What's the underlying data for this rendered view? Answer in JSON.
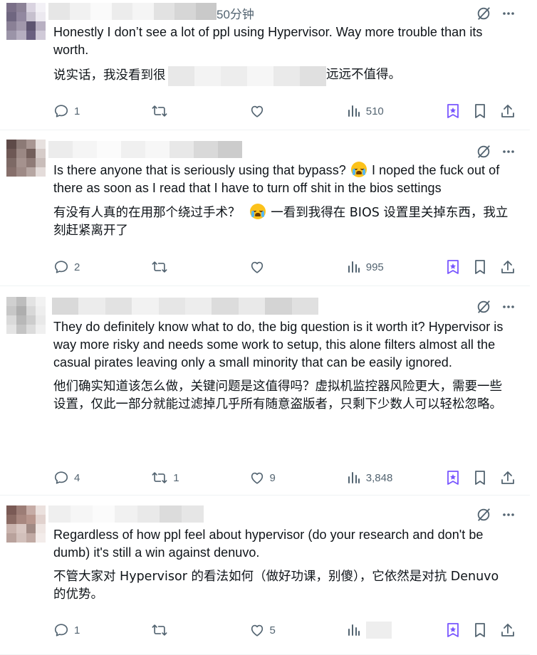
{
  "posts": [
    {
      "time": "50分钟",
      "text_en": "Honestly I don’t see a lot of ppl using Hypervisor. Way more trouble than its worth.",
      "text_zh_start": "说实话，我没看到很",
      "text_zh_end": "远远不值得。",
      "replies": "1",
      "reposts": "",
      "likes": "",
      "views": "510"
    },
    {
      "text_en_before": "Is there anyone that is seriously using that bypass?",
      "text_en_after": "I noped the fuck out of there as soon as I read that I have to turn off shit in the bios settings",
      "text_zh_before": "有没有人真的在用那个绕过手术？",
      "text_zh_after": "一看到我得在 BIOS 设置里关掉东西，我立刻赶紧离开了",
      "replies": "2",
      "reposts": "",
      "likes": "",
      "views": "995"
    },
    {
      "text_en": "They do definitely know what to do, the big question is it worth it? Hypervisor is way more risky and needs some work to setup, this alone filters almost all the casual pirates leaving only a small minority that can be easily ignored.",
      "text_zh": "他们确实知道该怎么做，关键问题是这值得吗？虚拟机监控器风险更大，需要一些设置，仅此一部分就能过滤掉几乎所有随意盗版者，只剩下少数人可以轻松忽略。",
      "replies": "4",
      "reposts": "1",
      "likes": "9",
      "views": "3,848"
    },
    {
      "text_en": "Regardless of how ppl feel about hypervisor (do your research and don't be dumb) it's still a win against denuvo.",
      "text_zh": "不管大家对 Hypervisor 的看法如何（做好功课，别傻），它依然是对抗 Denuvo 的优势。",
      "replies": "1",
      "reposts": "",
      "likes": "5",
      "views": ""
    }
  ],
  "colors": {
    "text": "#0f1419",
    "secondary": "#536471",
    "grok": "#7856ff",
    "divider": "#eff3f4"
  },
  "icons": [
    "grok-icon",
    "more-icon",
    "reply-icon",
    "repost-icon",
    "like-icon",
    "views-icon",
    "grok-bookmark-icon",
    "bookmark-icon",
    "share-icon"
  ]
}
